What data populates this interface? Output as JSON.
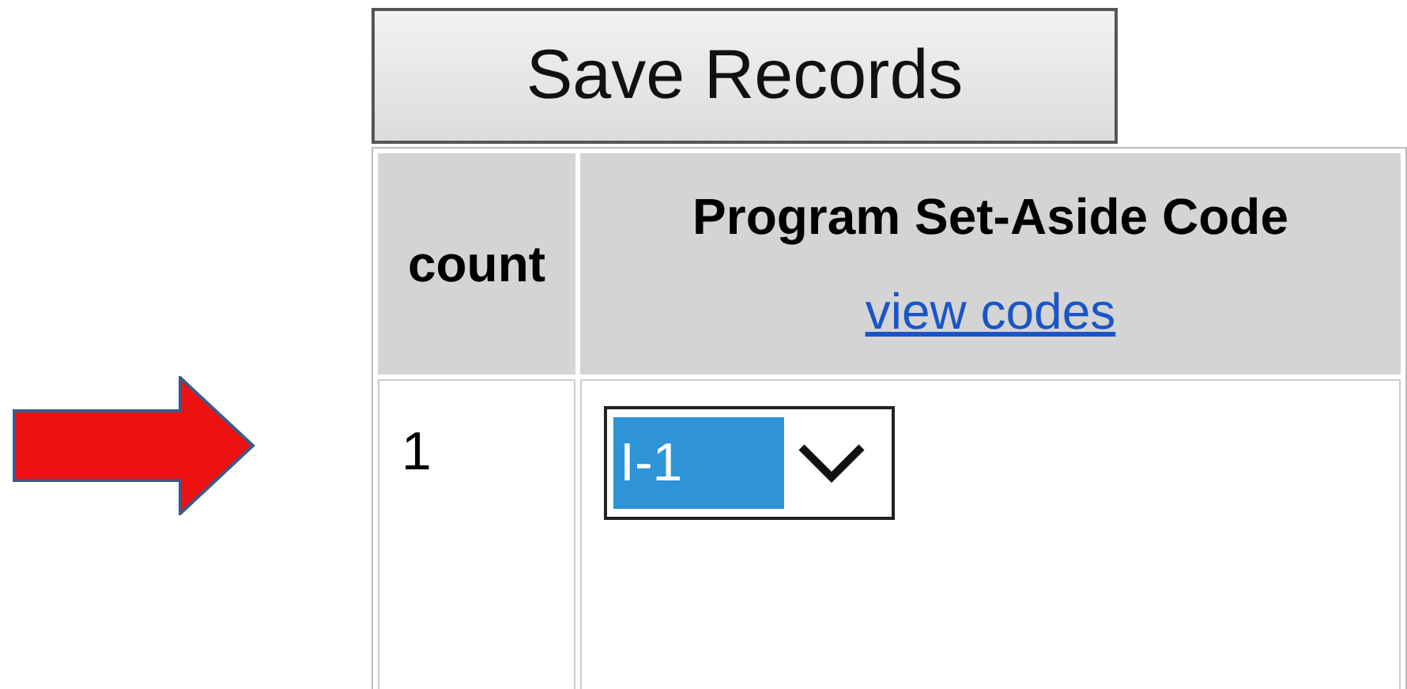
{
  "save_button": {
    "label": "Save Records"
  },
  "table": {
    "columns": [
      {
        "label": "count"
      },
      {
        "label": "Program Set-Aside Code",
        "link": "view codes"
      }
    ],
    "rows": [
      {
        "count": "1",
        "code": {
          "value": "I-1",
          "selected": true
        }
      }
    ]
  }
}
